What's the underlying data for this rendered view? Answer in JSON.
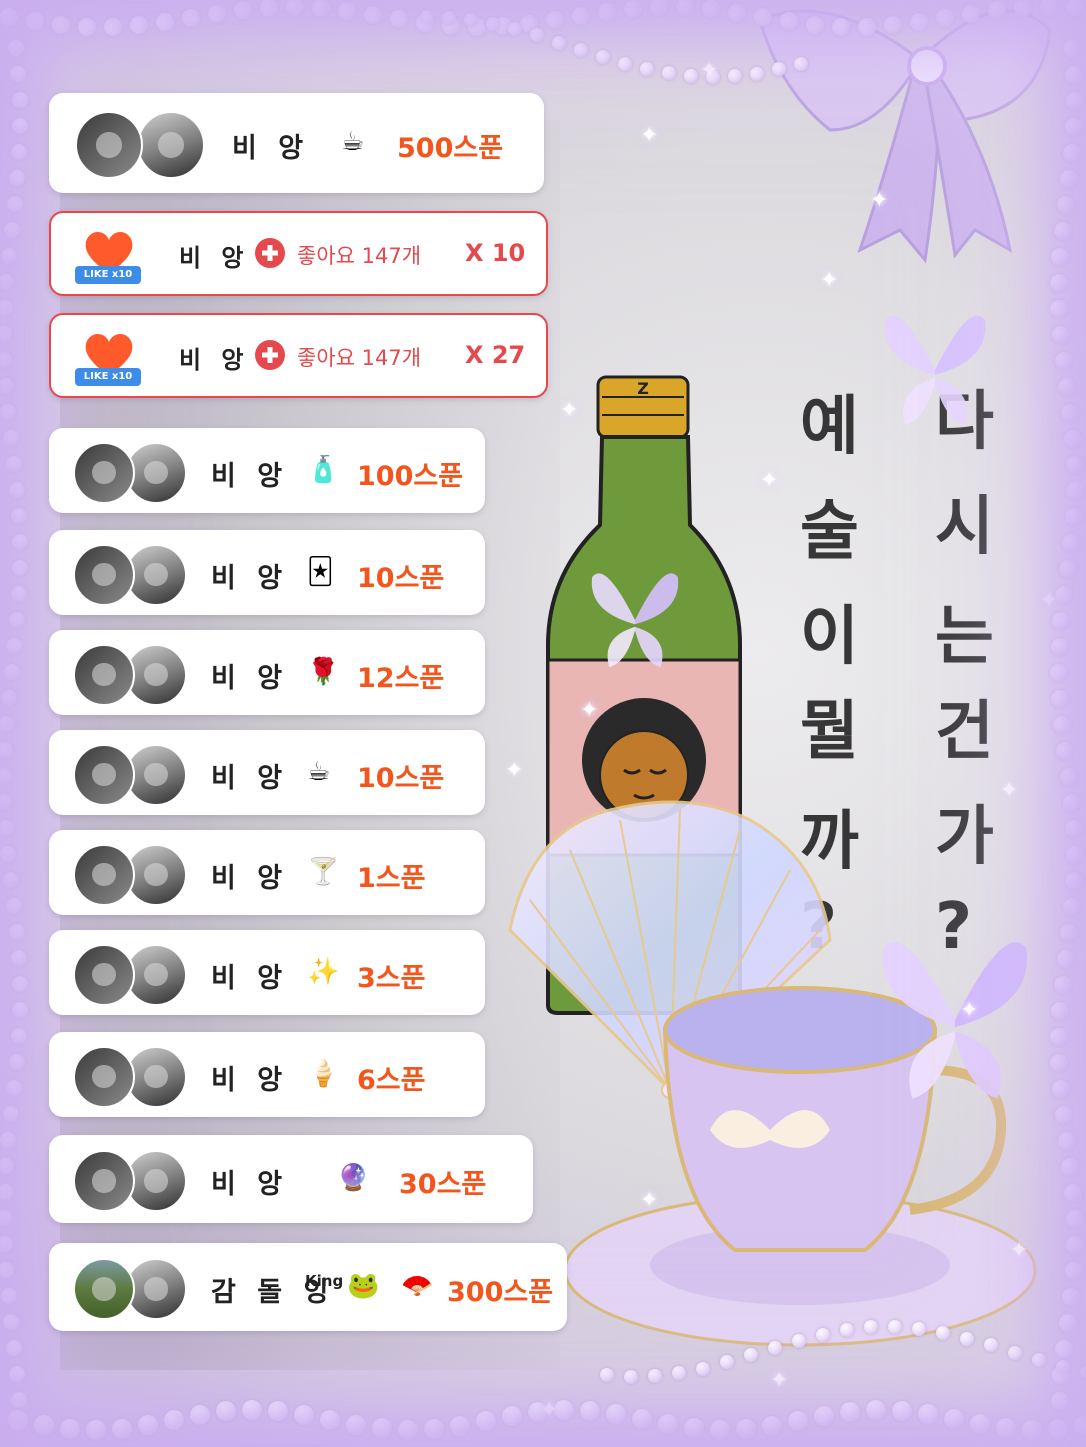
{
  "gift_feed": [
    {
      "type": "gift",
      "name": "비 앙",
      "gift_icon": "teacup-icon",
      "gift_glyph": "☕",
      "amount": "500스푼"
    },
    {
      "type": "like",
      "badge": "LIKE x10",
      "name": "비 앙",
      "text": "좋아요 147개",
      "multiplier": "X 10"
    },
    {
      "type": "like",
      "badge": "LIKE x10",
      "name": "비 앙",
      "text": "좋아요 147개",
      "multiplier": "X 27"
    },
    {
      "type": "gift",
      "name": "비 앙",
      "gift_icon": "perfume-icon",
      "gift_glyph": "🧴",
      "amount": "100스푼"
    },
    {
      "type": "gift",
      "name": "비 앙",
      "gift_icon": "tarot-card-icon",
      "gift_glyph": "🃏",
      "amount": "10스푼"
    },
    {
      "type": "gift",
      "name": "비 앙",
      "gift_icon": "rose-icon",
      "gift_glyph": "🌹",
      "amount": "12스푼"
    },
    {
      "type": "gift",
      "name": "비 앙",
      "gift_icon": "teacup-icon",
      "gift_glyph": "☕",
      "amount": "10스푼"
    },
    {
      "type": "gift",
      "name": "비 앙",
      "gift_icon": "cocktail-icon",
      "gift_glyph": "🍸",
      "amount": "1스푼"
    },
    {
      "type": "gift",
      "name": "비 앙",
      "gift_icon": "sparkles-icon",
      "gift_glyph": "✨",
      "amount": "3스푼"
    },
    {
      "type": "gift",
      "name": "비 앙",
      "gift_icon": "ice-cream-cone-icon",
      "gift_glyph": "🍦",
      "amount": "6스푼"
    },
    {
      "type": "gift",
      "name": "비 앙",
      "gift_icon": "crystal-ball-icon",
      "gift_glyph": "🔮",
      "amount": "30스푼"
    },
    {
      "type": "gift",
      "name": "감 돌 잉",
      "tag": "King",
      "tag_emoji": "🐸",
      "gift_icon": "folding-fan-icon",
      "gift_glyph": "🪭",
      "amount": "300스푼"
    }
  ],
  "wall_text": {
    "left_column": [
      "예",
      "술",
      "이",
      "뭘",
      "까",
      "?"
    ],
    "right_column": [
      "다",
      "시",
      "는",
      "건",
      "가",
      "?"
    ]
  },
  "bottle_cap_letter": "Z",
  "colors": {
    "amount": "#f2561d",
    "like_red": "#e5484d",
    "like_badge": "#3d8de8",
    "lavender": "#c9b3e6"
  }
}
